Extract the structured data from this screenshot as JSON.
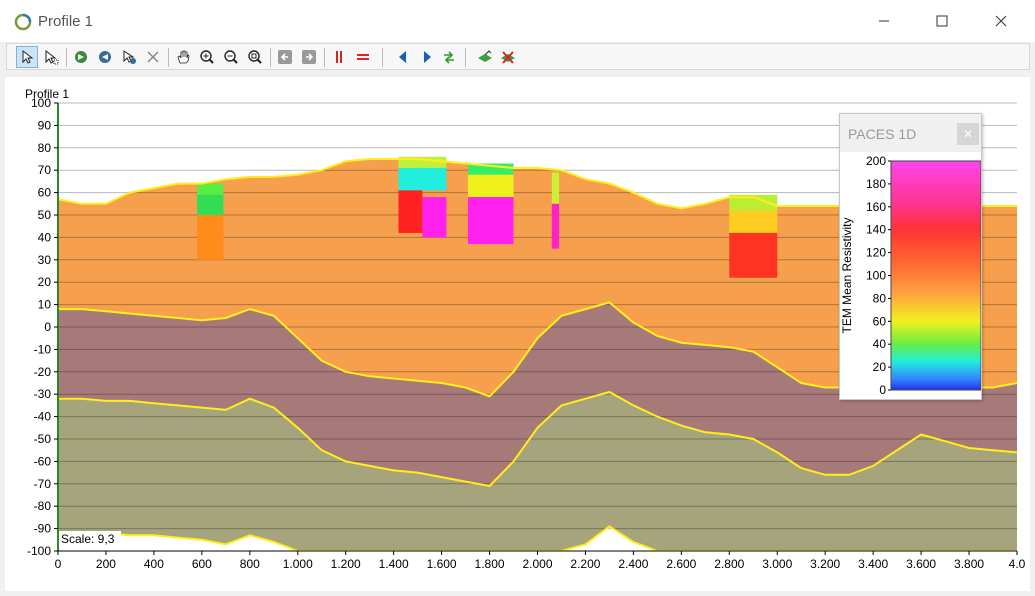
{
  "window": {
    "title": "Profile 1",
    "minimize_icon": "minimize-icon",
    "maximize_icon": "maximize-icon",
    "close_icon": "close-icon"
  },
  "toolbar": {
    "tools": [
      {
        "name": "select-arrow-icon",
        "active": true
      },
      {
        "name": "select-multi-icon",
        "active": false
      },
      {
        "name": "rotate-left-icon",
        "active": false
      },
      {
        "name": "rotate-right-icon",
        "active": false
      },
      {
        "name": "pointer-settings-icon",
        "active": false
      },
      {
        "name": "delete-x-icon",
        "active": false
      },
      {
        "name": "pan-hand-icon",
        "active": false
      },
      {
        "name": "zoom-in-icon",
        "active": false
      },
      {
        "name": "zoom-out-icon",
        "active": false
      },
      {
        "name": "zoom-extent-icon",
        "active": false
      },
      {
        "name": "arrow-left-box-icon",
        "active": false
      },
      {
        "name": "arrow-right-box-icon",
        "active": false
      },
      {
        "name": "vertical-lines-icon",
        "active": false
      },
      {
        "name": "horizontal-lines-icon",
        "active": false
      },
      {
        "name": "triangle-left-icon",
        "active": false
      },
      {
        "name": "triangle-right-icon",
        "active": false
      },
      {
        "name": "swap-arrows-icon",
        "active": false
      },
      {
        "name": "layer-add-icon",
        "active": false
      },
      {
        "name": "layer-remove-icon",
        "active": false
      }
    ]
  },
  "chart_data": {
    "type": "area",
    "title": "Profile 1",
    "scale_text": "Scale: 9,3",
    "xlim": [
      0,
      4000
    ],
    "ylim": [
      -100,
      100
    ],
    "x_ticks": [
      0,
      200,
      400,
      600,
      800,
      1000,
      1200,
      1400,
      1600,
      1800,
      2000,
      2200,
      2400,
      2600,
      2800,
      3000,
      3200,
      3400,
      3600,
      3800,
      4000
    ],
    "x_tick_labels": [
      "0",
      "200",
      "400",
      "600",
      "800",
      "1.000",
      "1.200",
      "1.400",
      "1.600",
      "1.800",
      "2.000",
      "2.200",
      "2.400",
      "2.600",
      "2.800",
      "3.000",
      "3.200",
      "3.400",
      "3.600",
      "3.800",
      "4.0"
    ],
    "y_ticks": [
      100,
      90,
      80,
      70,
      60,
      50,
      40,
      30,
      20,
      10,
      0,
      -10,
      -20,
      -30,
      -40,
      -50,
      -60,
      -70,
      -80,
      -90,
      -100
    ],
    "y_tick_labels": [
      "100",
      "90",
      "80",
      "70",
      "60",
      "50",
      "40",
      "30",
      "20",
      "10",
      "0",
      "-10",
      "-20",
      "-30",
      "-40",
      "-50",
      "-60",
      "-70",
      "-80",
      "-90",
      "-100"
    ],
    "grid": true,
    "boundaries": {
      "x": [
        0,
        100,
        200,
        300,
        400,
        500,
        600,
        700,
        800,
        900,
        1000,
        1100,
        1200,
        1300,
        1400,
        1500,
        1600,
        1700,
        1800,
        1900,
        2000,
        2100,
        2200,
        2300,
        2400,
        2500,
        2600,
        2700,
        2800,
        2900,
        3000,
        3100,
        3200,
        3300,
        3400,
        3500,
        3600,
        3700,
        3800,
        3900,
        4000
      ],
      "surface": [
        57,
        55,
        55,
        60,
        62,
        64,
        64,
        66,
        67,
        67,
        68,
        70,
        74,
        75,
        75,
        75,
        74,
        73,
        72,
        71,
        71,
        70,
        66,
        64,
        60,
        55,
        53,
        55,
        58,
        58,
        54,
        54,
        54,
        54,
        54,
        54,
        54,
        54,
        54,
        54,
        54
      ],
      "layer1_bottom": [
        8,
        8,
        7,
        6,
        5,
        4,
        3,
        4,
        8,
        5,
        -5,
        -15,
        -20,
        -22,
        -23,
        -24,
        -25,
        -27,
        -31,
        -20,
        -5,
        5,
        8,
        11,
        2,
        -4,
        -7,
        -8,
        -9,
        -11,
        -18,
        -25,
        -27,
        -27,
        -27,
        -27,
        -27,
        -27,
        -27,
        -27,
        -25
      ],
      "layer2_bottom": [
        -32,
        -32,
        -33,
        -33,
        -34,
        -35,
        -36,
        -37,
        -32,
        -36,
        -45,
        -55,
        -60,
        -62,
        -64,
        -65,
        -67,
        -69,
        -71,
        -60,
        -45,
        -35,
        -32,
        -29,
        -35,
        -40,
        -44,
        -47,
        -48,
        -50,
        -56,
        -63,
        -66,
        -66,
        -62,
        -55,
        -48,
        -51,
        -54,
        -55,
        -56
      ],
      "bottom_line": [
        -92,
        -92,
        -92,
        -93,
        -93,
        -94,
        -95,
        -97,
        -93,
        -96,
        -100,
        -100,
        -100,
        -100,
        -100,
        -100,
        -100,
        -100,
        -100,
        -100,
        -100,
        -100,
        -97,
        -89,
        -96,
        -100,
        -100,
        -100,
        -100,
        -100,
        -100,
        -100,
        -100,
        -100,
        -100,
        -100,
        -100,
        -100,
        -100,
        -100,
        -100
      ]
    },
    "layer_colors": {
      "layer1": "#f6a04e",
      "layer2": "#a77a7a",
      "layer3": "#a6a47c",
      "boundary": "#ffee1a",
      "white": "#ffffff"
    },
    "tem_columns": [
      {
        "x_start": 580,
        "x_end": 690,
        "top": 64,
        "segments": [
          {
            "from": 64,
            "to": 59,
            "color": "#55ee44"
          },
          {
            "from": 59,
            "to": 50,
            "color": "#33dd55"
          },
          {
            "from": 50,
            "to": 30,
            "color": "#ff8c1a"
          }
        ]
      },
      {
        "x_start": 1420,
        "x_end": 1620,
        "top": 76,
        "segments": [
          {
            "from": 76,
            "to": 71,
            "color": "#bff03c"
          },
          {
            "from": 71,
            "to": 61,
            "color": "#22eedd"
          },
          {
            "from": 61,
            "to": 42,
            "color": "#ff2222"
          },
          {
            "from": 58,
            "to": 40,
            "color": "#ff22ee"
          }
        ]
      },
      {
        "x_start": 1710,
        "x_end": 1900,
        "top": 73,
        "segments": [
          {
            "from": 73,
            "to": 68,
            "color": "#33ee66"
          },
          {
            "from": 68,
            "to": 58,
            "color": "#eef01a"
          },
          {
            "from": 58,
            "to": 37,
            "color": "#ff22ee"
          }
        ]
      },
      {
        "x_start": 2060,
        "x_end": 2090,
        "top": 69,
        "segments": [
          {
            "from": 69,
            "to": 55,
            "color": "#ccf033"
          },
          {
            "from": 55,
            "to": 35,
            "color": "#ff22cc"
          }
        ]
      },
      {
        "x_start": 2800,
        "x_end": 3000,
        "top": 59,
        "segments": [
          {
            "from": 59,
            "to": 52,
            "color": "#bbee33"
          },
          {
            "from": 52,
            "to": 42,
            "color": "#ffcc22"
          },
          {
            "from": 42,
            "to": 22,
            "color": "#ff3322"
          }
        ]
      }
    ],
    "legend": {
      "title": "PACES 1D",
      "label": "TEM Mean Resistivity",
      "ticks": [
        200,
        180,
        160,
        140,
        120,
        100,
        80,
        60,
        40,
        20,
        0
      ],
      "range": [
        0,
        200
      ],
      "gradient": [
        {
          "value": 200,
          "color": "#ff44ee"
        },
        {
          "value": 160,
          "color": "#ff3388"
        },
        {
          "value": 140,
          "color": "#ff3333"
        },
        {
          "value": 110,
          "color": "#ff6a33"
        },
        {
          "value": 85,
          "color": "#ffa040"
        },
        {
          "value": 60,
          "color": "#f2f020"
        },
        {
          "value": 40,
          "color": "#66ee44"
        },
        {
          "value": 25,
          "color": "#22eedd"
        },
        {
          "value": 10,
          "color": "#3388ff"
        },
        {
          "value": 0,
          "color": "#2233ee"
        }
      ]
    }
  }
}
